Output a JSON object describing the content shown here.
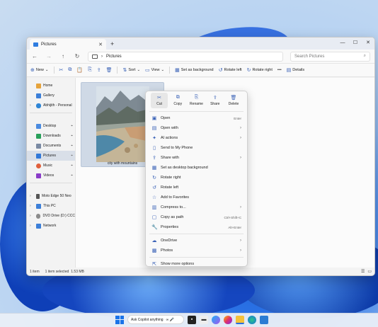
{
  "window": {
    "tab_title": "Pictures",
    "new_tab": "+",
    "minimize": "—",
    "maximize": "☐",
    "close": "✕"
  },
  "address": {
    "back": "←",
    "forward": "→",
    "up": "↑",
    "refresh": "↻",
    "crumb_sep": "›",
    "crumb": "Pictures",
    "search_placeholder": "Search Pictures",
    "search_icon": "⌕"
  },
  "toolbar": {
    "new": "New",
    "sort": "Sort",
    "view": "View",
    "set_bg": "Set as background",
    "rotate_left": "Rotate left",
    "rotate_right": "Rotate right",
    "more": "•••",
    "details": "Details",
    "icons": {
      "cut": "✂",
      "copy": "⧉",
      "paste": "📋",
      "rename": "⎘",
      "share": "⇪",
      "delete": "🗑"
    }
  },
  "nav": {
    "home": "Home",
    "gallery": "Gallery",
    "onedrive": "Abhijith - Personal",
    "desktop": "Desktop",
    "downloads": "Downloads",
    "documents": "Documents",
    "pictures": "Pictures",
    "music": "Music",
    "videos": "Videos",
    "phone": "Moto Edge 50 Neo",
    "thispc": "This PC",
    "dvd": "DVD Drive (D:) CCC",
    "network": "Network",
    "pin_glyph": "⌖",
    "chev": "›"
  },
  "content": {
    "thumb_caption": "city with mountains"
  },
  "status": {
    "count": "1 item",
    "selected": "1 item selected",
    "size": "1.53 MB",
    "details_view": "☰",
    "tiles_view": "▭"
  },
  "context_menu": {
    "actions": [
      {
        "icon": "✂",
        "label": "Cut"
      },
      {
        "icon": "⧉",
        "label": "Copy"
      },
      {
        "icon": "⎘",
        "label": "Rename"
      },
      {
        "icon": "⇪",
        "label": "Share"
      },
      {
        "icon": "🗑",
        "label": "Delete"
      }
    ],
    "items": [
      {
        "icon": "▣",
        "label": "Open",
        "shortcut": "Enter",
        "arrow": ""
      },
      {
        "icon": "▤",
        "label": "Open with",
        "shortcut": "",
        "arrow": "›"
      },
      {
        "icon": "✦",
        "label": "AI actions",
        "shortcut": "",
        "arrow": "›"
      },
      {
        "icon": "▯",
        "label": "Send to My Phone",
        "shortcut": "",
        "arrow": ""
      },
      {
        "icon": "⇪",
        "label": "Share with",
        "shortcut": "",
        "arrow": "›"
      },
      {
        "icon": "▦",
        "label": "Set as desktop background",
        "shortcut": "",
        "arrow": ""
      },
      {
        "icon": "↻",
        "label": "Rotate right",
        "shortcut": "",
        "arrow": ""
      },
      {
        "icon": "↺",
        "label": "Rotate left",
        "shortcut": "",
        "arrow": ""
      },
      {
        "icon": "☆",
        "label": "Add to Favorites",
        "shortcut": "",
        "arrow": ""
      },
      {
        "icon": "▥",
        "label": "Compress to...",
        "shortcut": "",
        "arrow": "›"
      },
      {
        "icon": "▢",
        "label": "Copy as path",
        "shortcut": "Ctrl+Shift+C",
        "arrow": ""
      },
      {
        "icon": "🔧",
        "label": "Properties",
        "shortcut": "Alt+Enter",
        "arrow": ""
      },
      {
        "icon": "☁",
        "label": "OneDrive",
        "shortcut": "",
        "arrow": "›"
      },
      {
        "icon": "▩",
        "label": "Photos",
        "shortcut": "",
        "arrow": "›"
      },
      {
        "icon": "⇱",
        "label": "Show more options",
        "shortcut": "",
        "arrow": ""
      }
    ]
  },
  "taskbar": {
    "copilot_placeholder": "Ask Copilot anything",
    "copilot_icons": "∞ 🎤"
  },
  "colors": {
    "accent": "#3a62b7",
    "selection": "#d9dfe8",
    "wallpaper": "#2b73e6"
  }
}
